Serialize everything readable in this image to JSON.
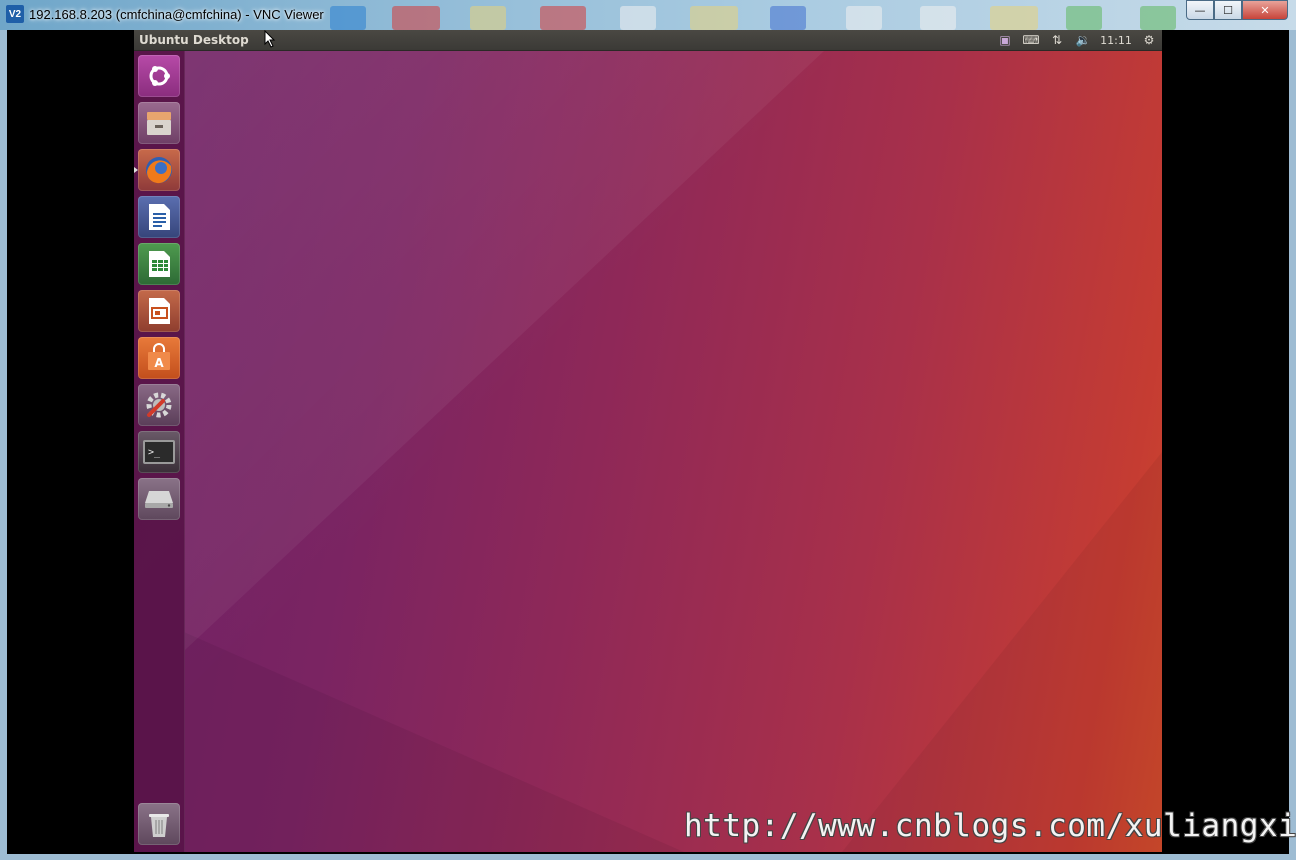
{
  "window": {
    "title": "192.168.8.203 (cmfchina@cmfchina) - VNC Viewer",
    "app_logo_text": "V2",
    "controls": {
      "minimize_glyph": "—",
      "maximize_glyph": "☐",
      "close_glyph": "✕"
    }
  },
  "ubuntu": {
    "panel_title": "Ubuntu Desktop",
    "indicators": [
      {
        "name": "display-indicator",
        "icon": "monitor-icon",
        "glyph": "▣"
      },
      {
        "name": "keyboard-indicator",
        "icon": "keyboard-icon",
        "glyph": "⌨"
      },
      {
        "name": "network-indicator",
        "icon": "network-updown-icon",
        "glyph": "⇅"
      },
      {
        "name": "sound-indicator",
        "icon": "speaker-icon",
        "glyph": "🔉"
      }
    ],
    "clock": "11:11",
    "session_glyph": "⚙",
    "launcher": [
      {
        "name": "dash-home",
        "icon": "ubuntu-logo-icon"
      },
      {
        "name": "files",
        "icon": "file-cabinet-icon"
      },
      {
        "name": "firefox",
        "icon": "firefox-icon",
        "running": true
      },
      {
        "name": "libreoffice-writer",
        "icon": "writer-document-icon"
      },
      {
        "name": "libreoffice-calc",
        "icon": "calc-spreadsheet-icon"
      },
      {
        "name": "libreoffice-impress",
        "icon": "impress-presentation-icon"
      },
      {
        "name": "ubuntu-software",
        "icon": "software-bag-icon"
      },
      {
        "name": "system-settings",
        "icon": "settings-wrench-icon"
      },
      {
        "name": "terminal",
        "icon": "terminal-icon"
      },
      {
        "name": "removable-drive",
        "icon": "drive-icon"
      },
      {
        "name": "trash",
        "icon": "trash-icon"
      }
    ],
    "terminal_prompt": ">_"
  },
  "watermark": "http://www.cnblogs.com/xuliangxing",
  "colors": {
    "launcher_bg": "#581448",
    "desktop_purple": "#6d1f63",
    "desktop_orange": "#cf4a2c",
    "panel_bg": "#3b3a36"
  }
}
